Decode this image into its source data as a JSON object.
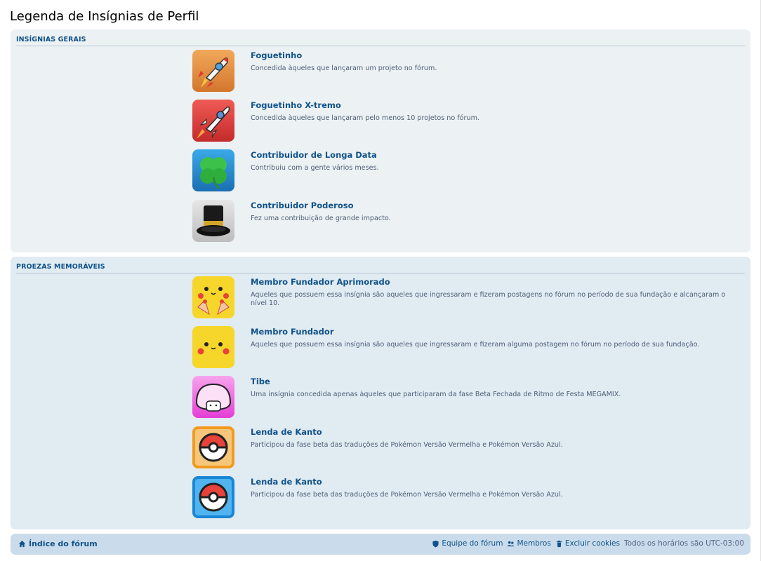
{
  "page": {
    "title": "Legenda de Insígnias de Perfil"
  },
  "sections": [
    {
      "header": "INSÍGNIAS GERAIS",
      "badges": [
        {
          "name": "Foguetinho",
          "description": "Concedida àqueles que lançaram um projeto no fórum.",
          "icon": "rocket-orange-icon"
        },
        {
          "name": "Foguetinho X-tremo",
          "description": "Concedida àqueles que lançaram pelo menos 10 projetos no fórum.",
          "icon": "rocket-red-icon"
        },
        {
          "name": "Contribuidor de Longa Data",
          "description": "Contribuiu com a gente vários meses.",
          "icon": "clover-icon"
        },
        {
          "name": "Contribuidor Poderoso",
          "description": "Fez uma contribuição de grande impacto.",
          "icon": "top-hat-icon"
        }
      ]
    },
    {
      "header": "PROEZAS MEMORÁVEIS",
      "badges": [
        {
          "name": "Membro Fundador Aprimorado",
          "description": "Aqueles que possuem essa insígnia são aqueles que ingressaram e fizeram postagens no fórum no período de sua fundação e alcançaram o nível 10.",
          "icon": "pikachu-party-icon"
        },
        {
          "name": "Membro Fundador",
          "description": "Aqueles que possuem essa insígnia são aqueles que ingressaram e fizeram alguma postagem no fórum no período de sua fundação.",
          "icon": "pikachu-face-icon"
        },
        {
          "name": "Tibe",
          "description": "Uma insígnia concedida apenas àqueles que participaram da fase Beta Fechada de Ritmo de Festa MEGAMIX.",
          "icon": "tibe-icon"
        },
        {
          "name": "Lenda de Kanto",
          "description": "Participou da fase beta das traduções de Pokémon Versão Vermelha e Pokémon Versão Azul.",
          "icon": "pokeball-orange-icon"
        },
        {
          "name": "Lenda de Kanto",
          "description": "Participou da fase beta das traduções de Pokémon Versão Vermelha e Pokémon Versão Azul.",
          "icon": "pokeball-blue-icon"
        }
      ]
    }
  ],
  "footer": {
    "index_label": "Índice do fórum",
    "team_label": "Equipe do fórum",
    "members_label": "Membros",
    "cookies_label": "Excluir cookies",
    "timezone_text": "Todos os horários são UTC-03:00"
  },
  "colors": {
    "link": "#105289",
    "panel_bg": "#ecf1f3",
    "footer_bg": "#cadceb"
  }
}
